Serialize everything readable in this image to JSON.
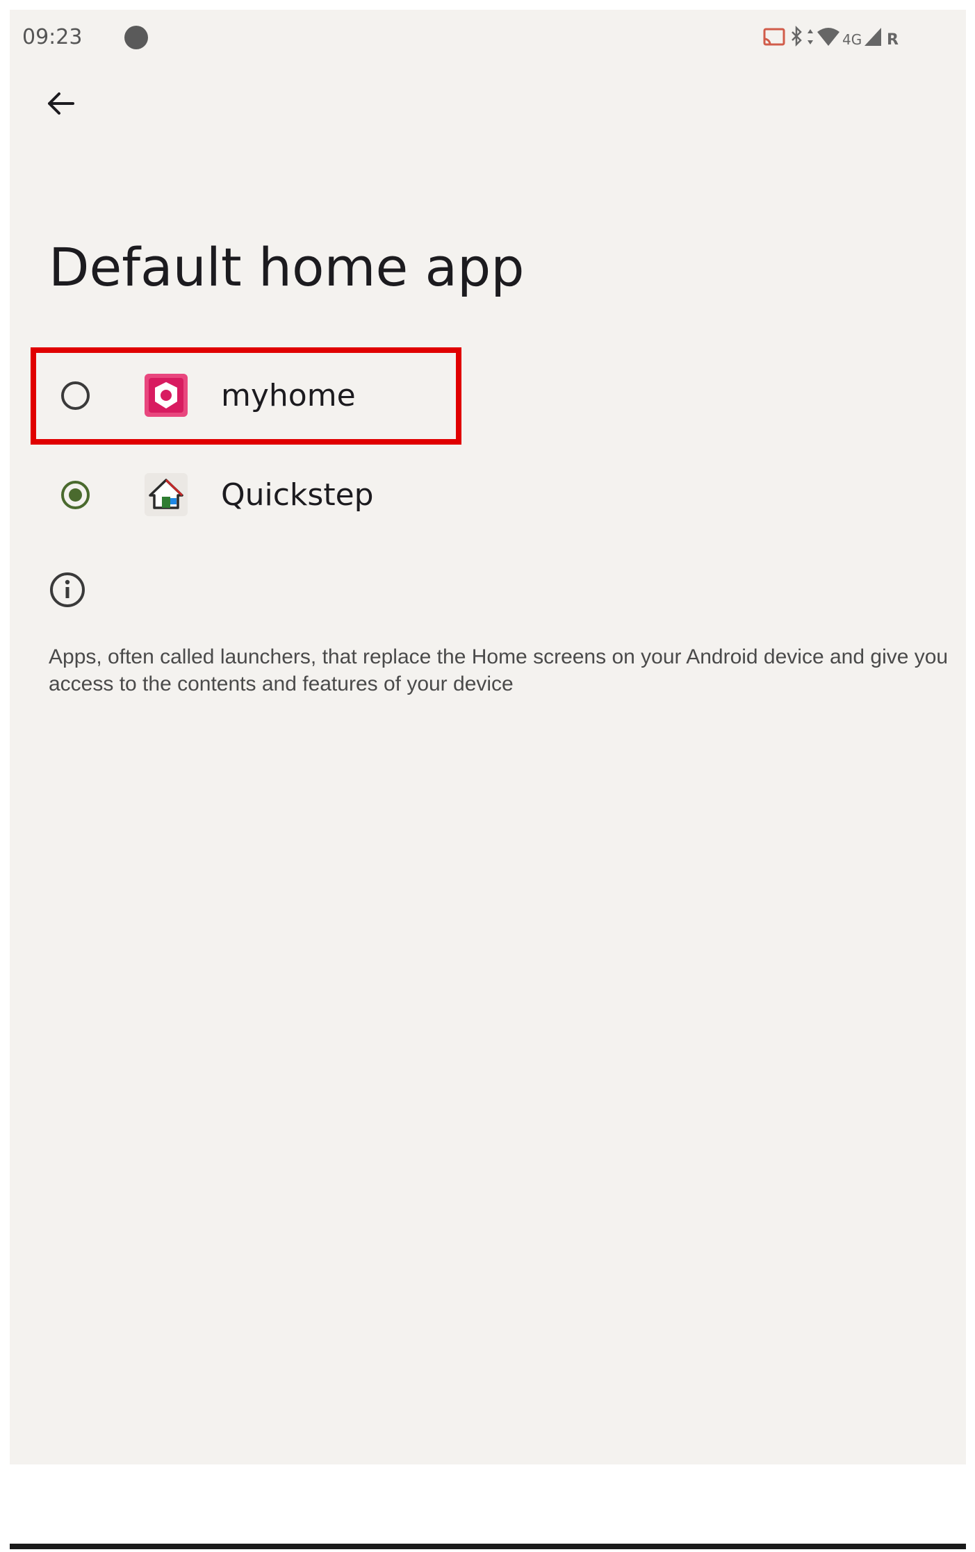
{
  "status_bar": {
    "time": "09:23",
    "network_label": "4G",
    "roaming_label": "R"
  },
  "header": {
    "title": "Default home app"
  },
  "options": [
    {
      "label": "myhome",
      "selected": false,
      "icon": "myhome-app-icon",
      "icon_color": "#d81b60"
    },
    {
      "label": "Quickstep",
      "selected": true,
      "icon": "house-icon",
      "icon_color": "#2e7d32"
    }
  ],
  "info": {
    "description": "Apps, often called launchers, that replace the Home screens on your Android device and give you access to the contents and features of your device"
  },
  "colors": {
    "accent_selected": "#4a6a2e",
    "highlight": "#e00000",
    "background": "#f4f2ef"
  }
}
